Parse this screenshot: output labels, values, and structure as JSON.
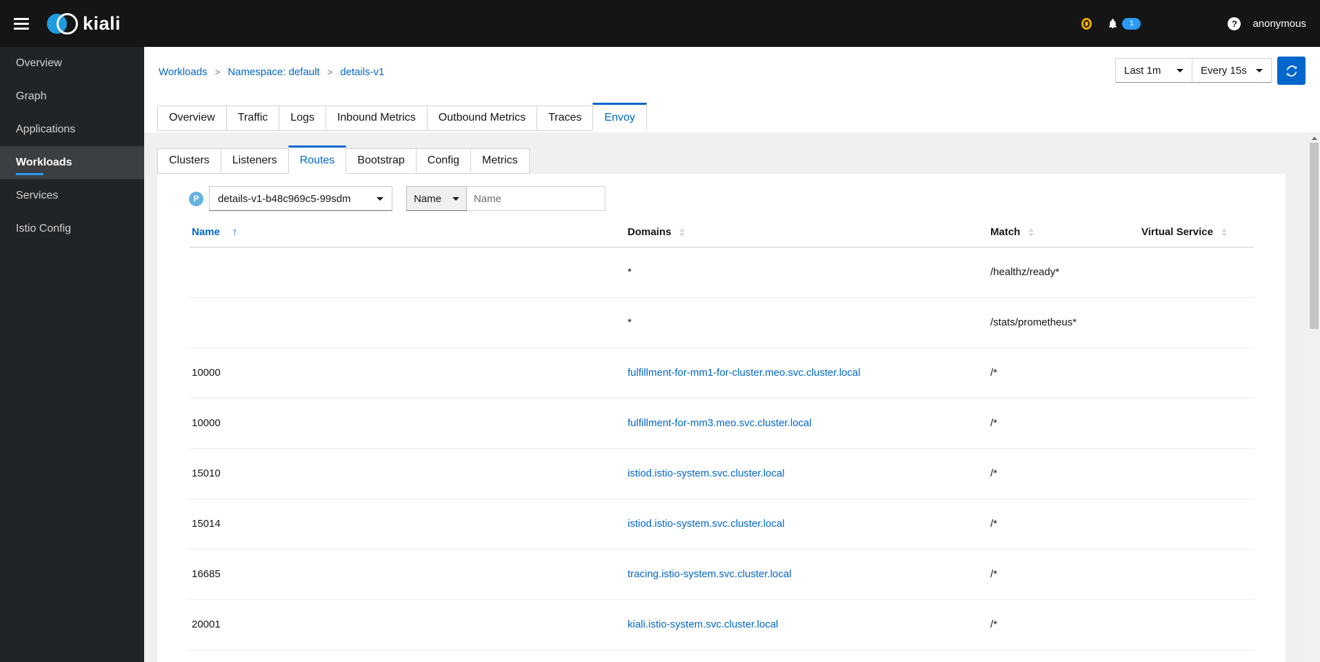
{
  "navbar": {
    "brand": "kiali",
    "notification_count": "1",
    "help_glyph": "?",
    "username": "anonymous"
  },
  "sidebar": {
    "items": [
      {
        "label": "Overview",
        "active": false
      },
      {
        "label": "Graph",
        "active": false
      },
      {
        "label": "Applications",
        "active": false
      },
      {
        "label": "Workloads",
        "active": true
      },
      {
        "label": "Services",
        "active": false
      },
      {
        "label": "Istio Config",
        "active": false
      }
    ]
  },
  "breadcrumb": {
    "items": [
      "Workloads",
      "Namespace: default",
      "details-v1"
    ],
    "separator": ">"
  },
  "toolbar": {
    "duration": "Last 1m",
    "refresh_interval": "Every 15s"
  },
  "main_tabs": {
    "items": [
      "Overview",
      "Traffic",
      "Logs",
      "Inbound Metrics",
      "Outbound Metrics",
      "Traces",
      "Envoy"
    ],
    "active": "Envoy"
  },
  "envoy_tabs": {
    "items": [
      "Clusters",
      "Listeners",
      "Routes",
      "Bootstrap",
      "Config",
      "Metrics"
    ],
    "active": "Routes"
  },
  "filters": {
    "pod_badge": "P",
    "pod_selected": "details-v1-b48c969c5-99sdm",
    "filter_type_selected": "Name",
    "filter_placeholder": "Name"
  },
  "routes_table": {
    "columns": [
      {
        "label": "Name",
        "sorted": "asc"
      },
      {
        "label": "Domains",
        "sorted": null
      },
      {
        "label": "Match",
        "sorted": null
      },
      {
        "label": "Virtual Service",
        "sorted": null
      }
    ],
    "rows": [
      {
        "name": "",
        "domains": "*",
        "domains_is_link": false,
        "match": "/healthz/ready*",
        "virtual_service": ""
      },
      {
        "name": "",
        "domains": "*",
        "domains_is_link": false,
        "match": "/stats/prometheus*",
        "virtual_service": ""
      },
      {
        "name": "10000",
        "domains": "fulfillment-for-mm1-for-cluster.meo.svc.cluster.local",
        "domains_is_link": true,
        "match": "/*",
        "virtual_service": ""
      },
      {
        "name": "10000",
        "domains": "fulfillment-for-mm3.meo.svc.cluster.local",
        "domains_is_link": true,
        "match": "/*",
        "virtual_service": ""
      },
      {
        "name": "15010",
        "domains": "istiod.istio-system.svc.cluster.local",
        "domains_is_link": true,
        "match": "/*",
        "virtual_service": ""
      },
      {
        "name": "15014",
        "domains": "istiod.istio-system.svc.cluster.local",
        "domains_is_link": true,
        "match": "/*",
        "virtual_service": ""
      },
      {
        "name": "16685",
        "domains": "tracing.istio-system.svc.cluster.local",
        "domains_is_link": true,
        "match": "/*",
        "virtual_service": ""
      },
      {
        "name": "20001",
        "domains": "kiali.istio-system.svc.cluster.local",
        "domains_is_link": true,
        "match": "/*",
        "virtual_service": ""
      }
    ]
  },
  "colors": {
    "link_blue": "#0066cc",
    "active_blue": "#2b9af3",
    "warning_orange": "#f0ab00",
    "masthead_bg": "#151515",
    "sidebar_bg": "#212427",
    "pod_badge_blue": "#65b2e0"
  }
}
